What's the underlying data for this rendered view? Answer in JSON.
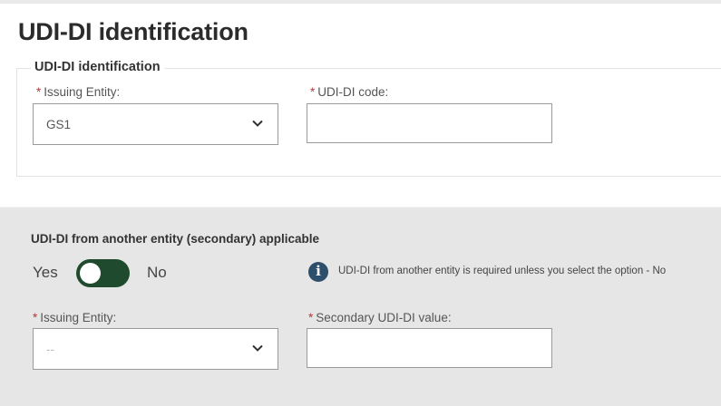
{
  "page": {
    "title": "UDI-DI identification"
  },
  "identification": {
    "legend": "UDI-DI identification",
    "issuing_entity": {
      "label": "Issuing Entity:",
      "required_mark": "*",
      "value": "GS1"
    },
    "udi_di_code": {
      "label": "UDI-DI code:",
      "required_mark": "*",
      "value": ""
    }
  },
  "secondary": {
    "heading": "UDI-DI from another entity (secondary) applicable",
    "toggle": {
      "yes_label": "Yes",
      "no_label": "No",
      "state": "on"
    },
    "info": {
      "icon": "info-icon",
      "text": "UDI-DI from another entity is required unless you select the option - No"
    },
    "issuing_entity": {
      "label": "Issuing Entity:",
      "required_mark": "*",
      "value": "--"
    },
    "secondary_value": {
      "label": "Secondary UDI-DI value:",
      "required_mark": "*",
      "value": ""
    }
  },
  "colors": {
    "toggle_on": "#1f4a2d",
    "required": "#b13b3b",
    "info_icon": "#2d4f6b",
    "section_bg": "#e6e6e6"
  }
}
